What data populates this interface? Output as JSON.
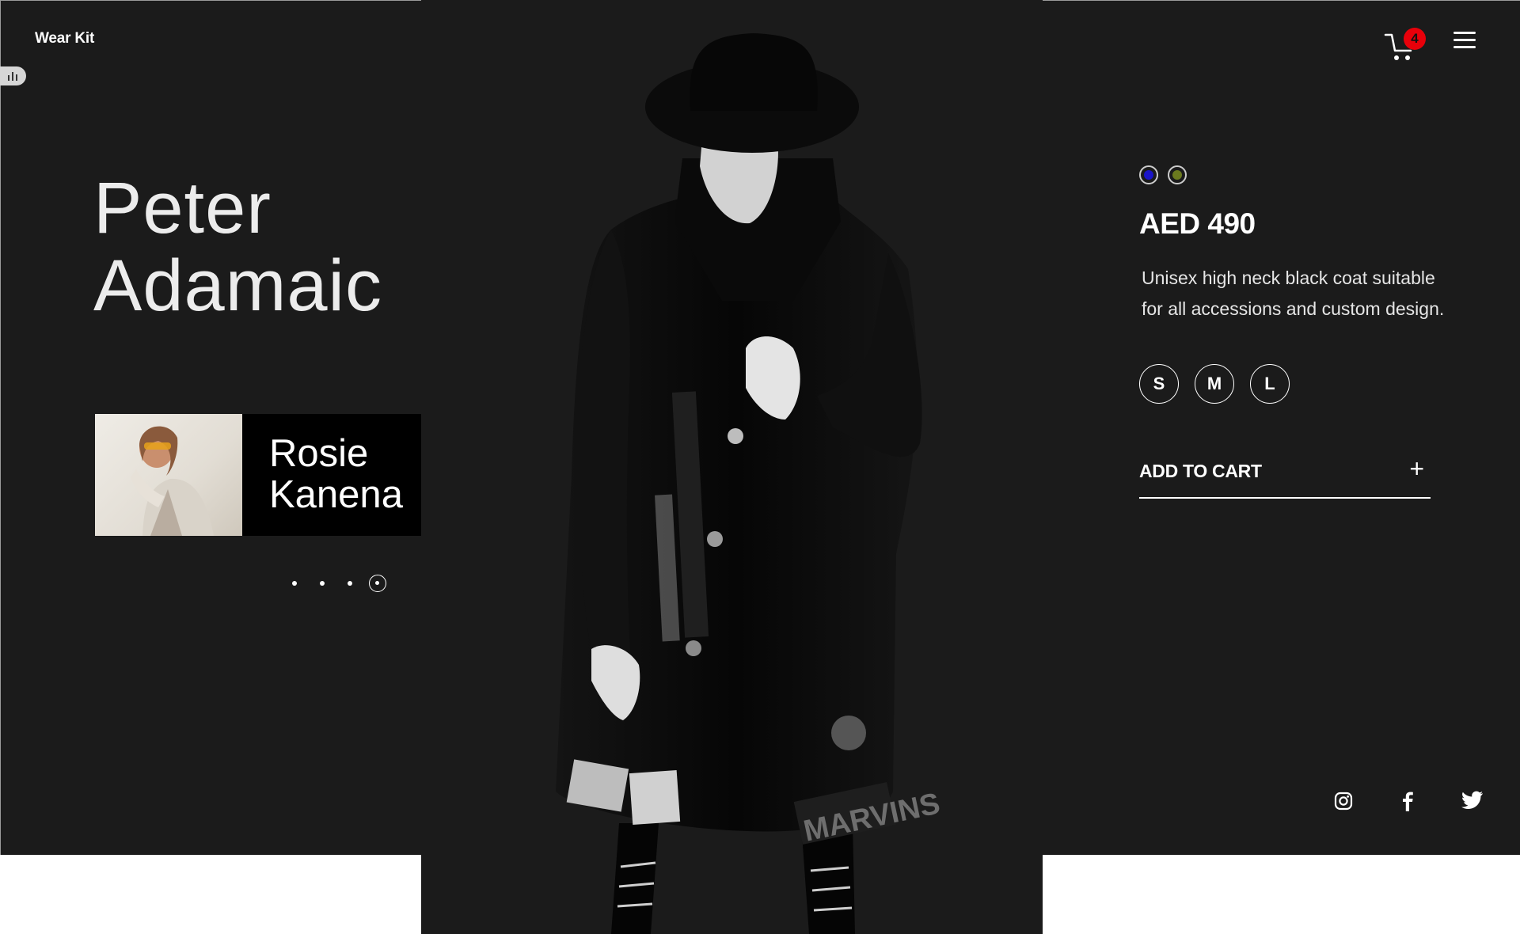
{
  "brand": {
    "logo_text": "Wear Kit"
  },
  "left": {
    "featured_name_line1": "Peter",
    "featured_name_line2": "Adamaic",
    "next_card": {
      "name_line1": "Rosie",
      "name_line2": "Kanena"
    },
    "pagination": {
      "count": 4,
      "active_index": 4
    }
  },
  "header": {
    "cart_count": "4"
  },
  "product": {
    "colors": [
      {
        "name": "blue",
        "hex": "#1a14c8"
      },
      {
        "name": "olive",
        "hex": "#6b7a1e"
      }
    ],
    "price": "AED 490",
    "description_line1": "Unisex high neck black coat  suitable",
    "description_line2": "for all accessions and custom design.",
    "sizes": [
      "S",
      "M",
      "L"
    ],
    "add_to_cart_label": "ADD TO CART"
  },
  "social": [
    "instagram-icon",
    "facebook-icon",
    "twitter-icon"
  ],
  "theme": {
    "background": "#1b1b1b",
    "accent_badge": "#e8000a",
    "text": "#ffffff"
  }
}
